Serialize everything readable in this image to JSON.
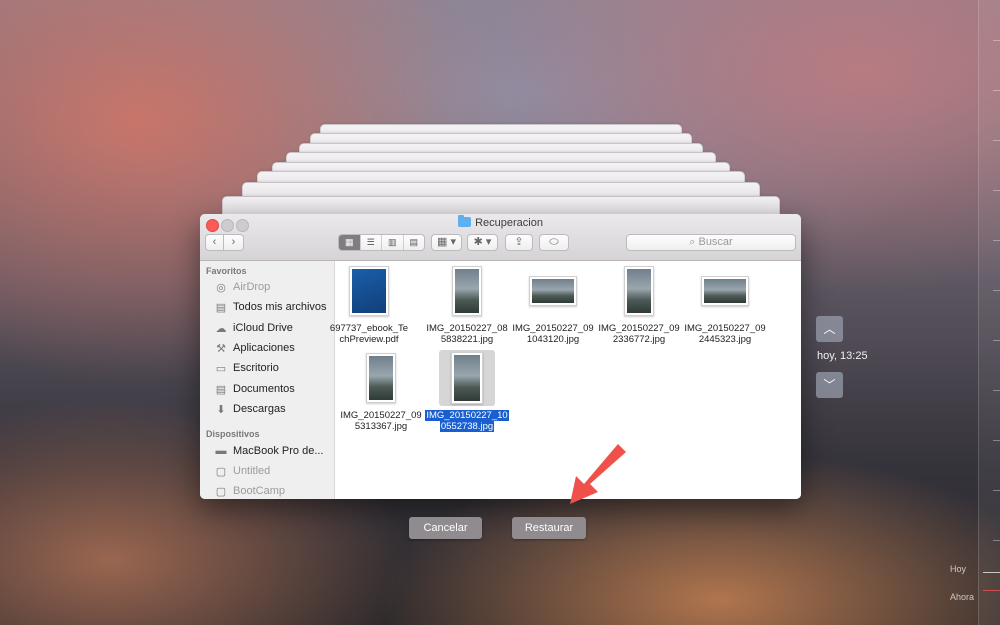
{
  "window": {
    "title": "Recuperacion",
    "folder_icon": "folder-icon"
  },
  "toolbar": {
    "back_label": "‹",
    "forward_label": "›",
    "view_icons": [
      "▦",
      "☰",
      "▥",
      "▤"
    ],
    "arrange_label": "▦ ▾",
    "action_label": "✱ ▾",
    "share_label": "⇪",
    "tags_label": "⬭",
    "search_placeholder": "⌕ Buscar"
  },
  "sidebar": {
    "favorites_heading": "Favoritos",
    "favorites": [
      {
        "label": "AirDrop",
        "icon": "airdrop-icon",
        "dim": true
      },
      {
        "label": "Todos mis archivos",
        "icon": "all-files-icon",
        "dim": false
      },
      {
        "label": "iCloud Drive",
        "icon": "cloud-icon",
        "dim": false
      },
      {
        "label": "Aplicaciones",
        "icon": "applications-icon",
        "dim": false
      },
      {
        "label": "Escritorio",
        "icon": "desktop-icon",
        "dim": false
      },
      {
        "label": "Documentos",
        "icon": "documents-icon",
        "dim": false
      },
      {
        "label": "Descargas",
        "icon": "downloads-icon",
        "dim": false
      }
    ],
    "devices_heading": "Dispositivos",
    "devices": [
      {
        "label": "MacBook Pro de...",
        "icon": "laptop-icon",
        "dim": false
      },
      {
        "label": "Untitled",
        "icon": "disk-icon",
        "dim": true
      },
      {
        "label": "BootCamp",
        "icon": "disk-icon",
        "dim": true
      }
    ]
  },
  "files": [
    {
      "line1": "697737_ebook_Te",
      "line2": "chPreview.pdf",
      "kind": "doc",
      "selected": false
    },
    {
      "line1": "IMG_20150227_08",
      "line2": "5838221.jpg",
      "kind": "portrait",
      "selected": false
    },
    {
      "line1": "IMG_20150227_09",
      "line2": "1043120.jpg",
      "kind": "landscape",
      "selected": false
    },
    {
      "line1": "IMG_20150227_09",
      "line2": "2336772.jpg",
      "kind": "portrait",
      "selected": false
    },
    {
      "line1": "IMG_20150227_09",
      "line2": "2445323.jpg",
      "kind": "landscape",
      "selected": false
    },
    {
      "line1": "IMG_20150227_09",
      "line2": "5313367.jpg",
      "kind": "portrait",
      "selected": false
    },
    {
      "line1": "IMG_20150227_10",
      "line2": "0552738.jpg",
      "kind": "portrait",
      "selected": true
    }
  ],
  "actions": {
    "cancel_label": "Cancelar",
    "restore_label": "Restaurar"
  },
  "time_machine": {
    "up_label": "︿",
    "down_label": "﹀",
    "timestamp": "hoy, 13:25",
    "timeline_label_today": "Hoy",
    "timeline_label_now": "Ahora"
  }
}
